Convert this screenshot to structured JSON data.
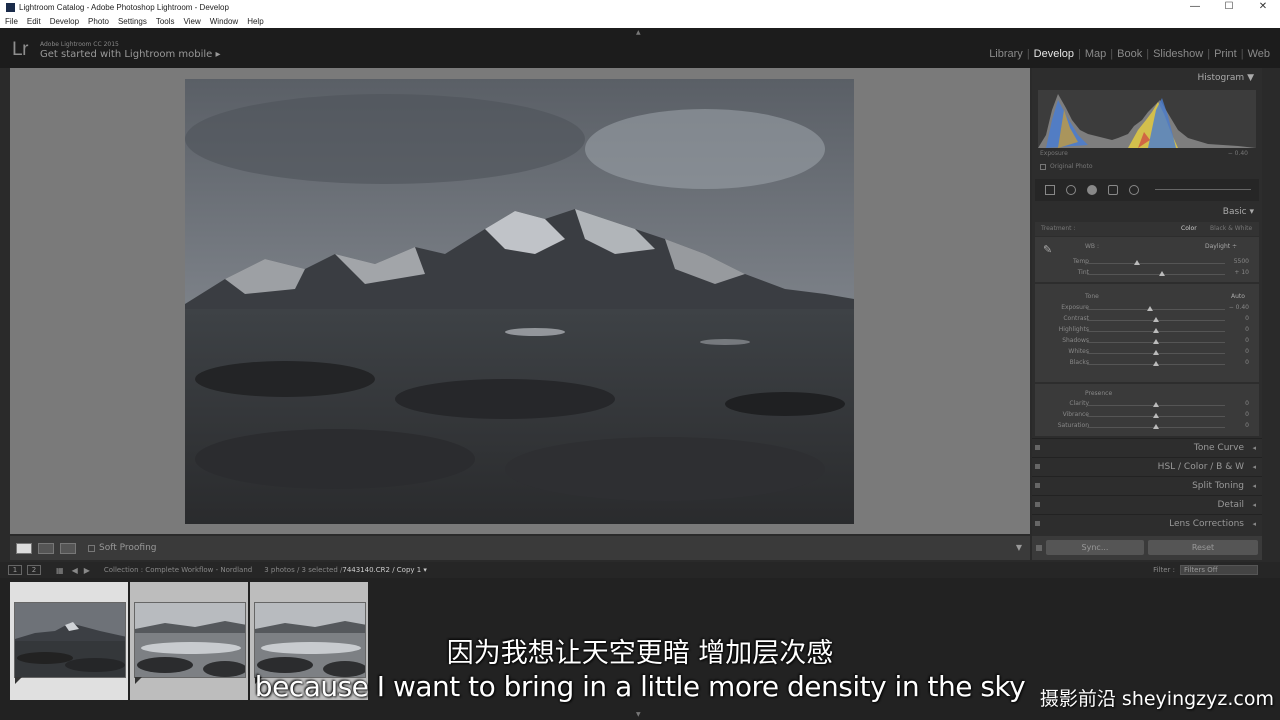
{
  "window": {
    "title": "Lightroom Catalog - Adobe Photoshop Lightroom - Develop",
    "controls": [
      "—",
      "☐",
      "✕"
    ]
  },
  "menu": [
    "File",
    "Edit",
    "Develop",
    "Photo",
    "Settings",
    "Tools",
    "View",
    "Window",
    "Help"
  ],
  "identity": {
    "logo": "Lr",
    "version": "Adobe Lightroom CC 2015",
    "mobile": "Get started with Lightroom mobile ▸"
  },
  "modules": [
    "Library",
    "Develop",
    "Map",
    "Book",
    "Slideshow",
    "Print",
    "Web"
  ],
  "active_module": "Develop",
  "toolbar": {
    "soft_proofing": "Soft Proofing"
  },
  "histogram": {
    "title": "Histogram",
    "info_left": "Exposure",
    "info_right": "− 0.40",
    "original_photo": "Original Photo"
  },
  "basic": {
    "title": "Basic",
    "treatment_label": "Treatment :",
    "treatment_color": "Color",
    "treatment_bw": "Black & White",
    "wb_label": "WB :",
    "wb_value": "Daylight ÷",
    "tone_label": "Tone",
    "tone_auto": "Auto",
    "presence_label": "Presence",
    "sliders_wb": [
      {
        "label": "Temp",
        "value": "5500",
        "pos": 0.36
      },
      {
        "label": "Tint",
        "value": "+ 10",
        "pos": 0.54
      }
    ],
    "sliders_tone": [
      {
        "label": "Exposure",
        "value": "− 0.40",
        "pos": 0.46
      },
      {
        "label": "Contrast",
        "value": "0",
        "pos": 0.5
      },
      {
        "label": "Highlights",
        "value": "0",
        "pos": 0.5
      },
      {
        "label": "Shadows",
        "value": "0",
        "pos": 0.5
      },
      {
        "label": "Whites",
        "value": "0",
        "pos": 0.5
      },
      {
        "label": "Blacks",
        "value": "0",
        "pos": 0.5
      }
    ],
    "sliders_presence": [
      {
        "label": "Clarity",
        "value": "0",
        "pos": 0.5
      },
      {
        "label": "Vibrance",
        "value": "0",
        "pos": 0.5
      },
      {
        "label": "Saturation",
        "value": "0",
        "pos": 0.5
      }
    ]
  },
  "collapsed_panels": [
    "Tone Curve",
    "HSL / Color / B & W",
    "Split Toning",
    "Detail",
    "Lens Corrections"
  ],
  "buttons": {
    "sync": "Sync...",
    "reset": "Reset"
  },
  "filmstrip": {
    "screen1": "1",
    "screen2": "2",
    "collection": "Collection : Complete Workflow - Nordland",
    "count": "3 photos / 3 selected /",
    "file": "7443140.CR2 / Copy 1 ▾",
    "filter_label": "Filter :",
    "filter_value": "Filters Off"
  },
  "subtitles": {
    "cn": "因为我想让天空更暗 增加层次感",
    "en": "because I want to bring in a little more density in the sky"
  },
  "watermark": "摄影前沿 sheyingzyz.com",
  "colors": {
    "panel_bg": "#2d2d2d",
    "canvas_bg": "#7a7a7a",
    "active_module": "#e6e6e6"
  }
}
